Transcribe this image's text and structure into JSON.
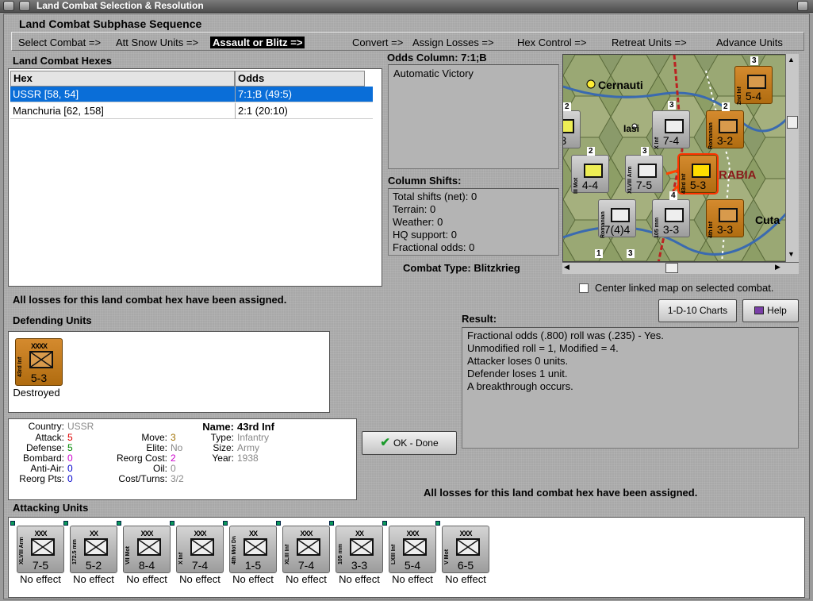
{
  "window": {
    "title": "Land Combat Selection & Resolution"
  },
  "sequence": {
    "heading": "Land Combat Subphase Sequence",
    "steps": [
      "Select Combat =>",
      "Att Snow Units =>",
      "Assault or Blitz =>",
      "Convert =>",
      "Assign Losses =>",
      "Hex Control =>",
      "Retreat Units =>",
      "Advance Units"
    ],
    "active_index": 2
  },
  "hexes": {
    "heading": "Land Combat Hexes",
    "columns": [
      "Hex",
      "Odds"
    ],
    "rows": [
      {
        "hex": "USSR [58, 54]",
        "odds": "7:1;B (49:5)"
      },
      {
        "hex": "Manchuria [62, 158]",
        "odds": "2:1 (20:10)"
      }
    ]
  },
  "odds": {
    "heading": "Odds Column: 7:1;B",
    "text": "Automatic Victory"
  },
  "shifts": {
    "heading": "Column Shifts:",
    "lines": [
      "Total shifts (net): 0",
      "Terrain: 0",
      "Weather: 0",
      "HQ support: 0",
      "Fractional odds: 0"
    ]
  },
  "combat_type": "Combat Type:  Blitzkrieg",
  "map": {
    "labels": {
      "cernauti": "Cernauti",
      "iasi": "Iasi",
      "rabia": "RABIA",
      "cuta": "Cuta"
    },
    "units": [
      {
        "str": "5-4",
        "side": "2nd Inf"
      },
      {
        "str": "7-4",
        "side": "X Inf"
      },
      {
        "str": "3-2",
        "side": "Romanian"
      },
      {
        "str": "4-4",
        "side": "III Mot"
      },
      {
        "str": "7-5",
        "side": "XLVIII Arm"
      },
      {
        "str": "5-3",
        "side": "43rd Inf"
      },
      {
        "str": "7(4)4",
        "side": "Romanian"
      },
      {
        "str": "3-3",
        "side": "105 mm"
      },
      {
        "str": "3-3",
        "side": "4th Inf"
      },
      {
        "str": "-3",
        "side": ""
      }
    ],
    "stack_counts": [
      "3",
      "3",
      "2",
      "2",
      "2",
      "3",
      "4",
      "1",
      "3"
    ]
  },
  "center_linked": "Center linked map on selected combat.",
  "buttons": {
    "charts": "1-D-10 Charts",
    "help": "Help",
    "ok": "OK - Done"
  },
  "losses_msg": "All losses for this land combat hex have been assigned.",
  "defending": {
    "heading": "Defending Units",
    "units": [
      {
        "size": "XXXX",
        "side": "43rd Inf",
        "str": "5-3",
        "status": "Destroyed"
      }
    ]
  },
  "result": {
    "heading": "Result:",
    "lines": [
      "Fractional odds (.800) roll was (.235)  - Yes.",
      "Unmodified roll = 1, Modified = 4.",
      "Attacker loses 0 units.",
      "Defender loses 1 unit.",
      "A breakthrough occurs."
    ]
  },
  "info": {
    "country_k": "Country:",
    "country_v": "USSR",
    "attack_k": "Attack:",
    "attack_v": "5",
    "defense_k": "Defense:",
    "defense_v": "5",
    "bombard_k": "Bombard:",
    "bombard_v": "0",
    "antiair_k": "Anti-Air:",
    "antiair_v": "0",
    "reorgpts_k": "Reorg Pts:",
    "reorgpts_v": "0",
    "move_k": "Move:",
    "move_v": "3",
    "elite_k": "Elite:",
    "elite_v": "No",
    "reorgcost_k": "Reorg Cost:",
    "reorgcost_v": "2",
    "oil_k": "Oil:",
    "oil_v": "0",
    "costturns_k": "Cost/Turns:",
    "costturns_v": "3/2",
    "name_k": "Name:",
    "name_v": "43rd Inf",
    "type_k": "Type:",
    "type_v": "Infantry",
    "size_k": "Size:",
    "size_v": "Army",
    "year_k": "Year:",
    "year_v": "1938"
  },
  "attacking": {
    "heading": "Attacking Units",
    "units": [
      {
        "size": "XXX",
        "side": "XLVIII Arm",
        "str": "7-5",
        "status": "No effect",
        "color": "grey"
      },
      {
        "size": "XX",
        "side": "172.5 mm",
        "str": "5-2",
        "status": "No effect",
        "color": "grey"
      },
      {
        "size": "XXX",
        "side": "VII Mot",
        "str": "8-4",
        "status": "No effect",
        "color": "grey"
      },
      {
        "size": "XXX",
        "side": "X Inf",
        "str": "7-4",
        "status": "No effect",
        "color": "grey"
      },
      {
        "size": "XX",
        "side": "4th Mot Div",
        "str": "1-5",
        "status": "No effect",
        "color": "grey"
      },
      {
        "size": "XXX",
        "side": "XLIII Inf",
        "str": "7-4",
        "status": "No effect",
        "color": "grey"
      },
      {
        "size": "XX",
        "side": "105 mm",
        "str": "3-3",
        "status": "No effect",
        "color": "grey"
      },
      {
        "size": "XXX",
        "side": "LXIII Inf",
        "str": "5-4",
        "status": "No effect",
        "color": "grey"
      },
      {
        "size": "XXX",
        "side": "V Mot",
        "str": "6-5",
        "status": "No effect",
        "color": "grey"
      }
    ]
  }
}
